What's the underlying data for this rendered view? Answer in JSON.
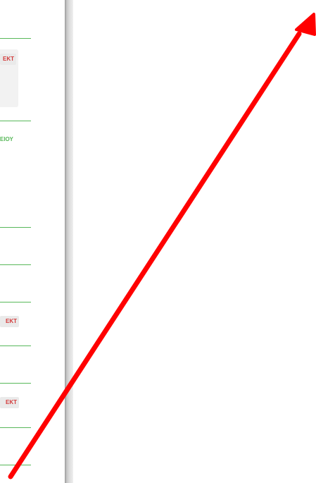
{
  "left_panel": {
    "badges": [
      "EKT",
      "EKT",
      "EKT"
    ],
    "green_text": "ΕΙΟΥ"
  },
  "annotation": {
    "type": "arrow",
    "color": "#ff0000",
    "direction": "up-right"
  },
  "colors": {
    "accent_green": "#58b85a",
    "badge_red": "#d33a3a",
    "card_grey": "#f2f2f2"
  }
}
